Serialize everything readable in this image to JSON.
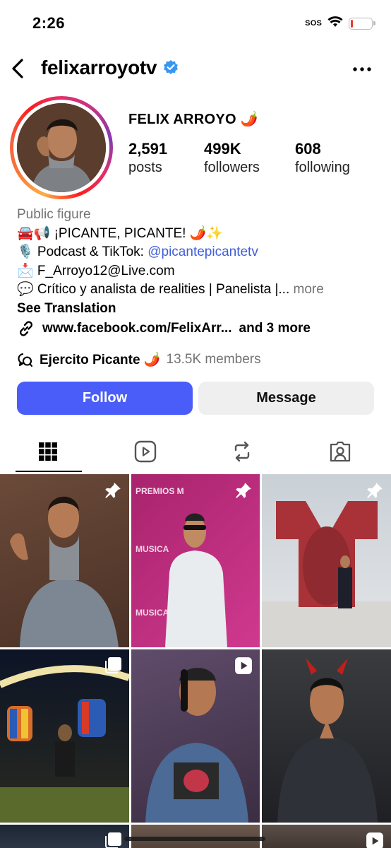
{
  "status_bar": {
    "time": "2:26",
    "sos": "SOS"
  },
  "header": {
    "username": "felixarroyotv",
    "back_icon": "chevron-left-icon",
    "more_icon": "more-horizontal-icon",
    "verified_icon": "verified-badge-icon"
  },
  "profile": {
    "display_name": "FELIX ARROYO 🌶️",
    "stats": [
      {
        "value": "2,591",
        "label": "posts"
      },
      {
        "value": "499K",
        "label": "followers"
      },
      {
        "value": "608",
        "label": "following"
      }
    ]
  },
  "bio": {
    "category": "Public figure",
    "line1": "🚘📢 ¡PICANTE, PICANTE! 🌶️✨",
    "line2_prefix": "🎙️ Podcast & TikTok: ",
    "line2_mention": "@picantepicantetv",
    "line3": "📩 F_Arroyo12@Live.com",
    "line4": "💬 Crítico y analista de realities | Panelista |...",
    "line4_more": " more",
    "see_translation": "See Translation"
  },
  "links": {
    "url": "www.facebook.com/FelixArr...",
    "more": "and 3 more"
  },
  "channel": {
    "name": "Ejercito Picante 🌶️",
    "members": "13.5K members"
  },
  "actions": {
    "follow": "Follow",
    "message": "Message"
  },
  "tabs": [
    "grid-icon",
    "reels-icon",
    "reposts-icon",
    "tagged-icon"
  ],
  "colors": {
    "accent": "#4a5df9",
    "mention": "#3f5dd8",
    "verified": "#3797f0",
    "muted": "#737373"
  },
  "grid_posts": [
    {
      "icon": "pin-icon"
    },
    {
      "icon": "pin-icon"
    },
    {
      "icon": "pin-icon"
    },
    {
      "icon": "carousel-icon"
    },
    {
      "icon": "reel-icon"
    },
    {
      "icon": "none"
    },
    {
      "icon": "carousel-icon"
    },
    {
      "icon": "none"
    },
    {
      "icon": "reel-icon"
    }
  ]
}
